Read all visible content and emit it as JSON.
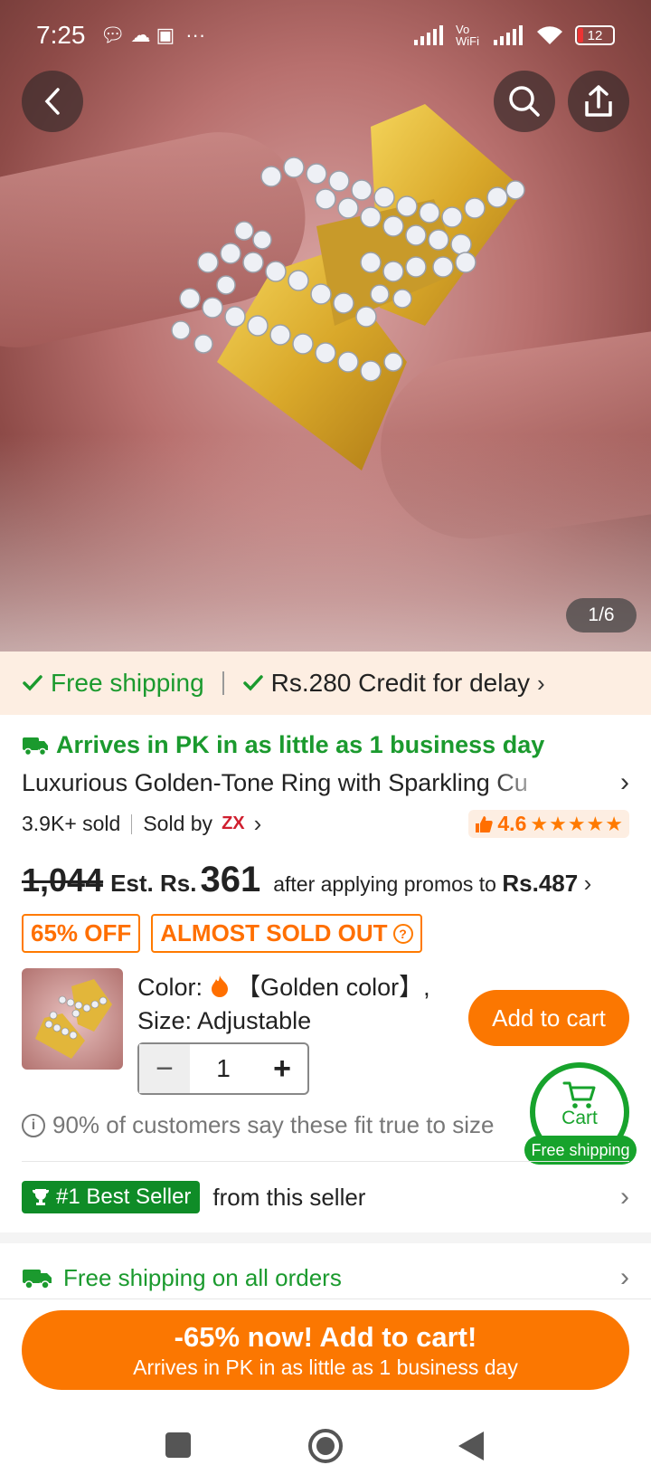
{
  "status_bar": {
    "time": "7:25",
    "notif_icons": [
      "chat-icon",
      "cloud-icon",
      "gamepad-icon"
    ],
    "more": "···",
    "network": "Vo WiFi",
    "battery": "12"
  },
  "gallery": {
    "counter": "1/6"
  },
  "shipping_strip": {
    "free_shipping": "Free shipping",
    "credit": "Rs.280 Credit for delay"
  },
  "delivery": {
    "arrives": "Arrives in PK in as little as 1 business day"
  },
  "product": {
    "title": "Luxurious Golden-Tone Ring with Sparkling Cu",
    "sold": "3.9K+ sold",
    "sold_by": "Sold by",
    "seller_logo": "ZX",
    "rating": "4.6",
    "stars": "★★★★★"
  },
  "price": {
    "original": "1,044",
    "est_label": "Est. Rs.",
    "current": "361",
    "promo_text": "after applying promos to",
    "promo_price": "Rs.487"
  },
  "badges": {
    "discount": "65% OFF",
    "stock": "ALMOST SOLD OUT",
    "stock_help": "?"
  },
  "sku": {
    "color_label": "Color:",
    "color_value": "【Golden color】,",
    "size_label": "Size: Adjustable",
    "quantity": "1",
    "minus": "−",
    "plus": "+",
    "add_to_cart": "Add to cart"
  },
  "fit": {
    "icon": "i",
    "text": "90% of customers say these fit true to size"
  },
  "floating_cart": {
    "label": "Cart",
    "pill": "Free shipping"
  },
  "best_seller": {
    "badge": "#1 Best Seller",
    "text": "from this seller"
  },
  "free_shipping_row": {
    "text": "Free shipping on all orders"
  },
  "cta": {
    "main": "-65% now! Add to cart!",
    "sub": "Arrives in PK in as little as 1 business day"
  },
  "colors": {
    "accent": "#fb7701",
    "green": "#1b9a2e",
    "strip_bg": "#fdeee2"
  }
}
